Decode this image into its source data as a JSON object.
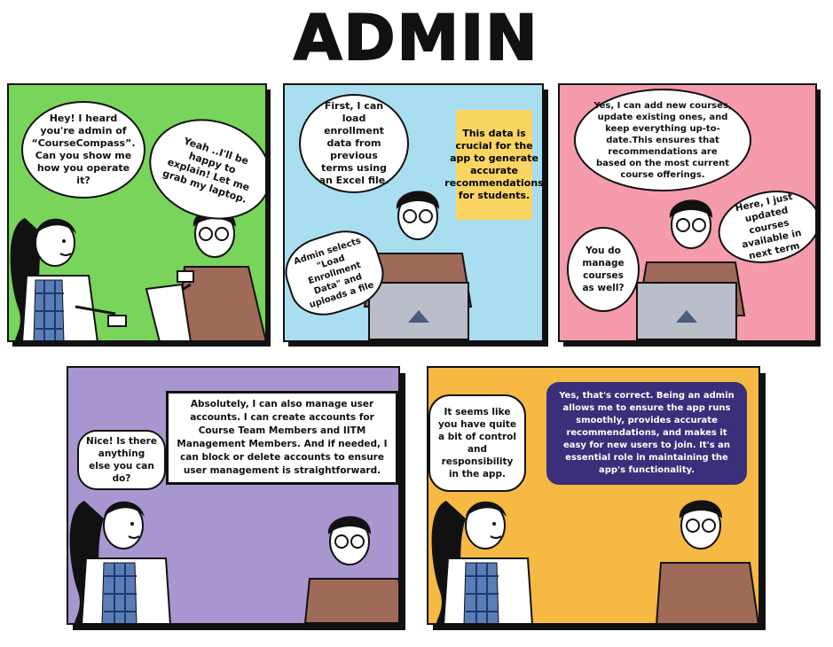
{
  "title": "ADMIN",
  "colors": {
    "panel1": "#78d45a",
    "panel2": "#a9def0",
    "panel3": "#f59bab",
    "panel4": "#a896d1",
    "panel5": "#f5b944",
    "yellow_note": "#fbd562",
    "navy_bubble": "#3a2f7a",
    "shirt": "#a06a58",
    "laptop": "#b9bec8"
  },
  "panel1": {
    "woman_speech": "Hey! I heard you're admin of “CourseCompass”. Can you show me how you operate it?",
    "man_speech": "Yeah ..I'll be happy to explain! Let me grab my laptop."
  },
  "panel2": {
    "admin_speech": "First, I can load enrollment data from previous terms using an Excel file.",
    "note": "This data is crucial for the app to generate accurate recommendations for students.",
    "action": "Admin selects \"Load Enrollment Data\" and uploads a file"
  },
  "panel3": {
    "admin_speech": "Yes, I can add new courses, update existing ones, and keep everything up-to-date.This ensures that recommendations are based on the most current course offerings.",
    "question": "You do manage courses as well?",
    "update_speech": "Here, I just updated courses available in next term"
  },
  "panel4": {
    "woman_speech": "Nice! Is there anything else you can do?",
    "admin_speech": "Absolutely, I can also manage user accounts. I can create accounts for Course Team Members and IITM Management Members. And if needed, I can block or delete accounts to ensure user management is straightforward."
  },
  "panel5": {
    "woman_speech": "It seems like you have quite a bit of control and responsibility in the app.",
    "admin_speech": "Yes, that's correct. Being an admin allows me to ensure the app runs smoothly, provides accurate recommendations, and makes it easy for new users to join. It's an essential role in maintaining the app's functionality."
  }
}
